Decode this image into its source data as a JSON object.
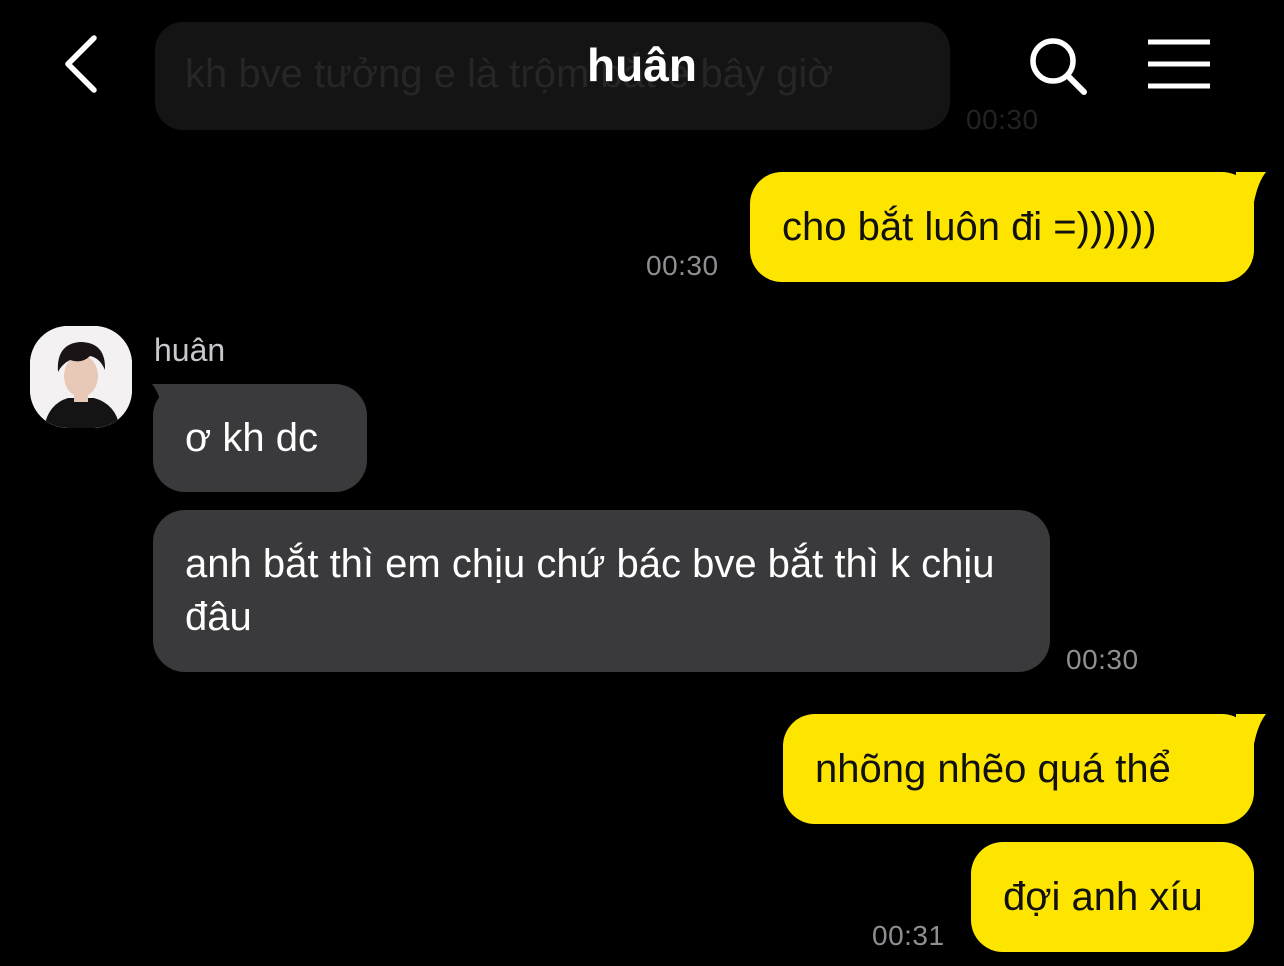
{
  "header": {
    "title": "huân"
  },
  "colors": {
    "outgoing_bubble": "#FEE500",
    "incoming_bubble": "#3A3A3C",
    "background": "#000000"
  },
  "icons": {
    "back": "chevron-left-icon",
    "search": "search-icon",
    "menu": "hamburger-menu-icon"
  },
  "messages": [
    {
      "direction": "incoming",
      "text": "kh bve tưởng e là trộm bắt e bây giờ",
      "time": "00:30",
      "partially_hidden": true
    },
    {
      "direction": "outgoing",
      "text": "cho bắt luôn đi =))))))",
      "time": "00:30"
    },
    {
      "direction": "incoming",
      "sender": "huân",
      "text": "ơ kh dc",
      "time": ""
    },
    {
      "direction": "incoming",
      "text": "anh bắt thì em chịu chứ bác bve bắt thì k chịu đâu",
      "time": "00:30"
    },
    {
      "direction": "outgoing",
      "text": "nhõng nhẽo quá thể",
      "time": ""
    },
    {
      "direction": "outgoing",
      "text": "đợi anh xíu",
      "time": "00:31"
    }
  ]
}
